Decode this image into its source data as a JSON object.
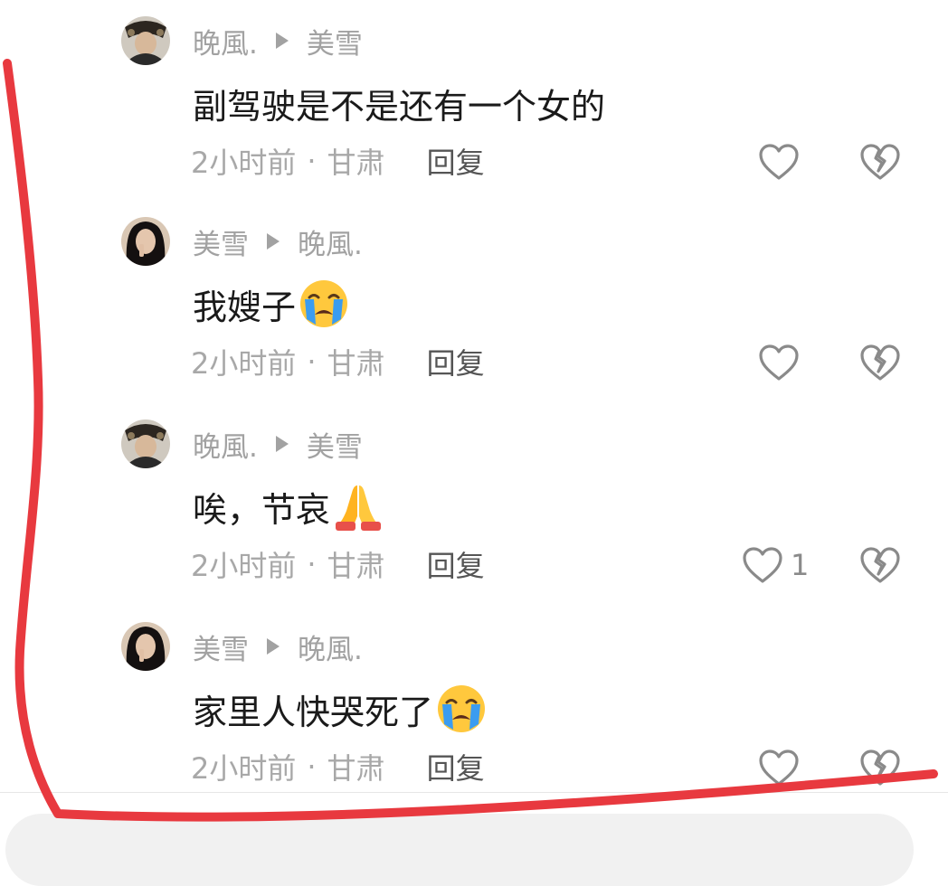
{
  "comments": [
    {
      "author": "晚風.",
      "reply_to": "美雪",
      "text": "副驾驶是不是还有一个女的",
      "emoji": "",
      "time": "2小时前",
      "location": "甘肃",
      "reply_label": "回复",
      "likes": "",
      "avatar": "male-avatar"
    },
    {
      "author": "美雪",
      "reply_to": "晚風.",
      "text": "我嫂子",
      "emoji": "loudly-crying-face",
      "time": "2小时前",
      "location": "甘肃",
      "reply_label": "回复",
      "likes": "",
      "avatar": "female-avatar"
    },
    {
      "author": "晚風.",
      "reply_to": "美雪",
      "text": "唉，节哀",
      "emoji": "folded-hands",
      "time": "2小时前",
      "location": "甘肃",
      "reply_label": "回复",
      "likes": "1",
      "avatar": "male-avatar"
    },
    {
      "author": "美雪",
      "reply_to": "晚風.",
      "text": "家里人快哭死了",
      "emoji": "loudly-crying-face",
      "time": "2小时前",
      "location": "甘肃",
      "reply_label": "回复",
      "likes": "",
      "avatar": "female-avatar"
    }
  ],
  "meta_separator": "·",
  "icons": {
    "like": "heart-outline-icon",
    "dislike": "broken-heart-outline-icon",
    "arrow": "play-arrow-icon"
  },
  "colors": {
    "annotation_stroke": "#e8393f",
    "muted_text": "#a2a2a2",
    "body_text": "#1a1a1a"
  }
}
